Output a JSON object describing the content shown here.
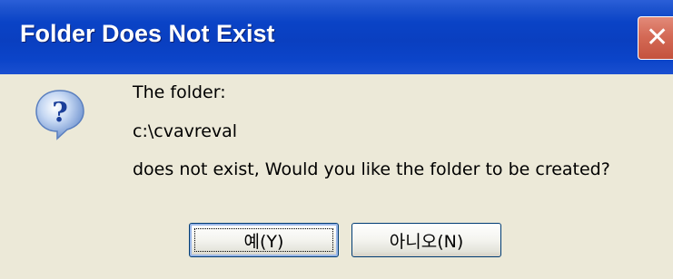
{
  "dialog": {
    "title": "Folder Does Not Exist",
    "close_glyph": "✕",
    "icon": "question-icon",
    "message_line1": "The folder:",
    "message_path": "c:\\cvavreval",
    "message_line3": "does not exist, Would you like the folder to be created?"
  },
  "buttons": {
    "yes_label": "예(Y)",
    "no_label": "아니오(N)"
  },
  "colors": {
    "titlebar": "#0a43c6",
    "body": "#ece9d8",
    "close_button": "#d46a56"
  }
}
